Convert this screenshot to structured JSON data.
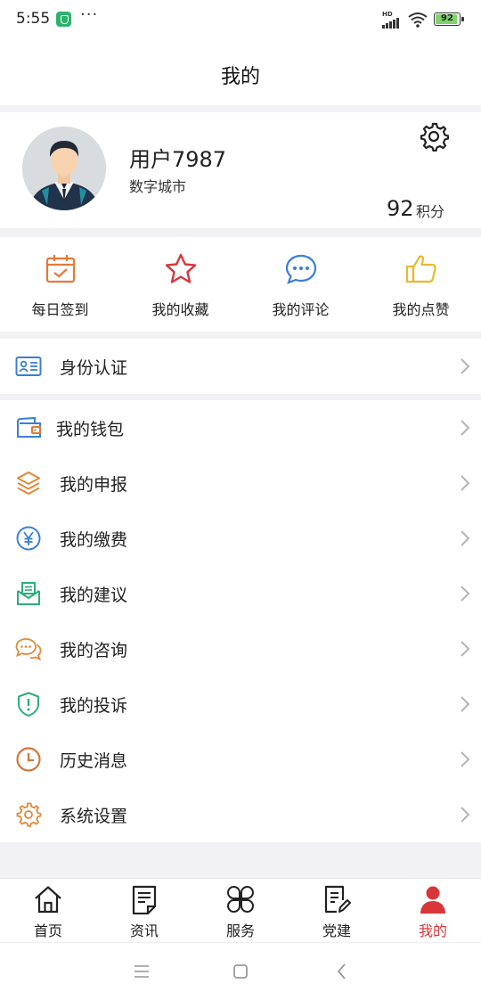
{
  "status_bar": {
    "time": "5:55",
    "more": "···",
    "network": "HD",
    "battery": "92"
  },
  "header": {
    "title": "我的"
  },
  "profile": {
    "username": "用户7987",
    "city": "数字城市",
    "points_value": "92",
    "points_label": "积分"
  },
  "quick_actions": [
    {
      "label": "每日签到",
      "icon": "calendar-check-icon",
      "color": "#e07b39"
    },
    {
      "label": "我的收藏",
      "icon": "star-icon",
      "color": "#d8363a"
    },
    {
      "label": "我的评论",
      "icon": "comment-bubble-icon",
      "color": "#3a7fd5"
    },
    {
      "label": "我的点赞",
      "icon": "thumbs-up-icon",
      "color": "#e8b92e"
    }
  ],
  "menu_groups": [
    [
      {
        "label": "身份认证",
        "icon": "id-card-icon"
      }
    ],
    [
      {
        "label": "我的钱包",
        "icon": "wallet-icon"
      },
      {
        "label": "我的申报",
        "icon": "layers-icon"
      },
      {
        "label": "我的缴费",
        "icon": "yen-circle-icon"
      },
      {
        "label": "我的建议",
        "icon": "mail-envelope-icon"
      },
      {
        "label": "我的咨询",
        "icon": "chat-bubbles-icon"
      },
      {
        "label": "我的投诉",
        "icon": "shield-alert-icon"
      },
      {
        "label": "历史消息",
        "icon": "clock-icon"
      },
      {
        "label": "系统设置",
        "icon": "gear-icon"
      }
    ]
  ],
  "tabs": [
    {
      "label": "首页",
      "icon": "home-icon",
      "active": false
    },
    {
      "label": "资讯",
      "icon": "news-icon",
      "active": false
    },
    {
      "label": "服务",
      "icon": "services-grid-icon",
      "active": false
    },
    {
      "label": "党建",
      "icon": "party-doc-icon",
      "active": false
    },
    {
      "label": "我的",
      "icon": "user-icon",
      "active": true
    }
  ],
  "colors": {
    "accent": "#d8363a",
    "page_bg": "#f2f2f5",
    "icon_blue": "#3a7fd5",
    "icon_orange": "#e07b39",
    "icon_green": "#2cae7a"
  }
}
